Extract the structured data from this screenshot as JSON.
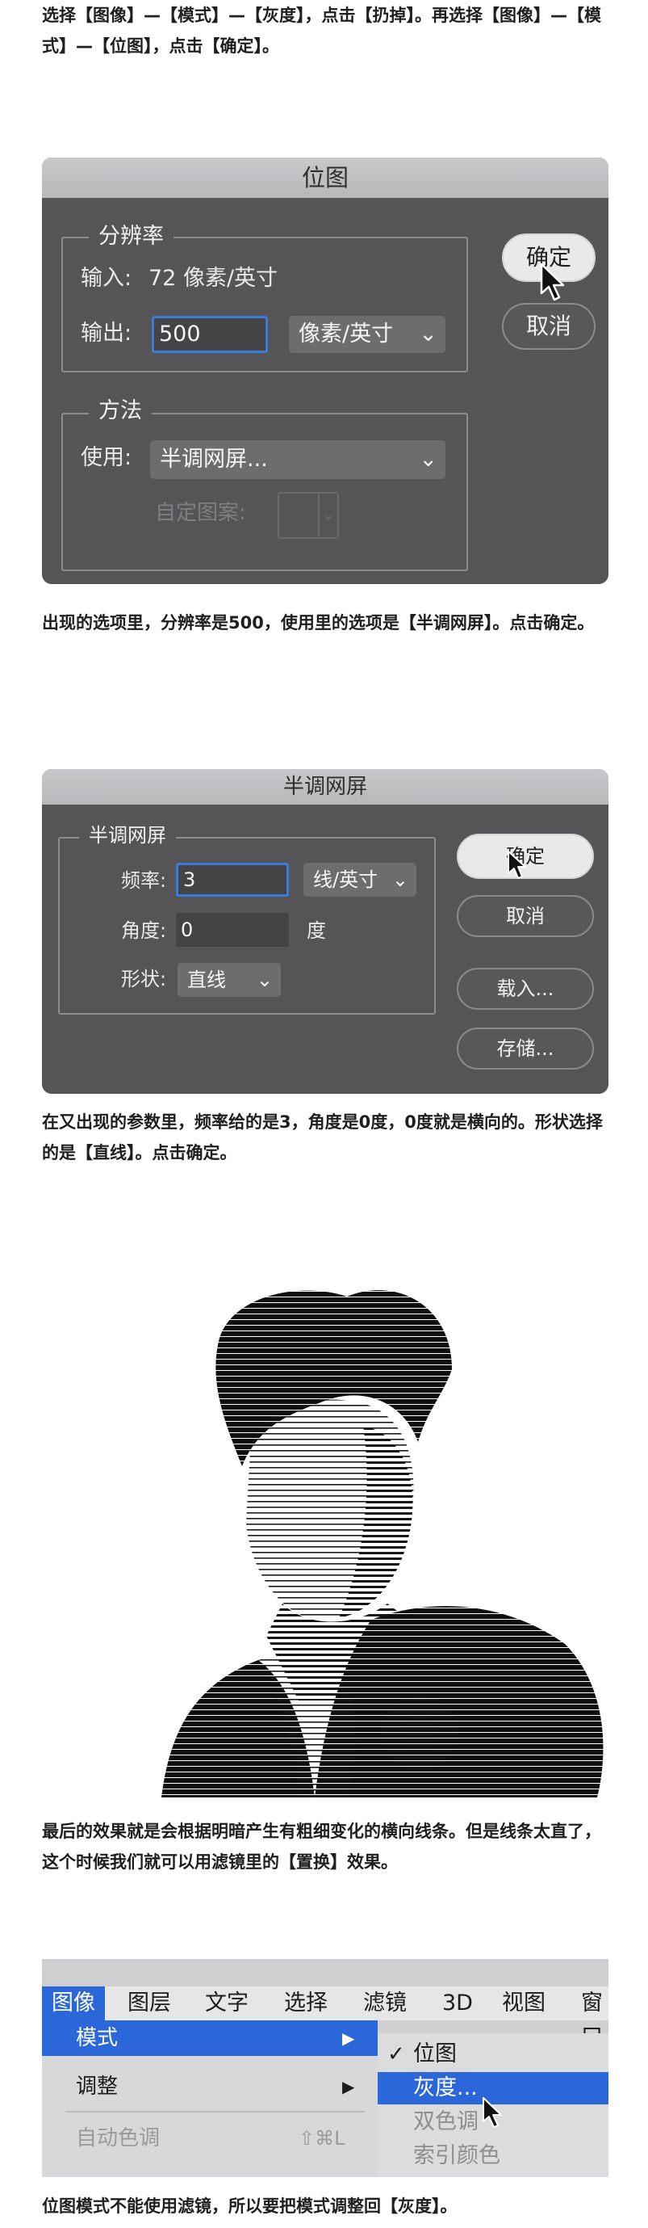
{
  "paragraphs": {
    "p1": "选择【图像】—【模式】—【灰度】，点击【扔掉】。再选择【图像】—【模式】—【位图】，点击【确定】。",
    "p2": "出现的选项里，分辨率是500，使用里的选项是【半调网屏】。点击确定。",
    "p3": "在又出现的参数里，频率给的是3，角度是0度，0度就是横向的。形状选择的是【直线】。点击确定。",
    "p4": "最后的效果就是会根据明暗产生有粗细变化的横向线条。但是线条太直了，这个时候我们就可以用滤镜里的【置换】效果。",
    "p5": "位图模式不能使用滤镜，所以要把模式调整回【灰度】。"
  },
  "bitmap_dialog": {
    "title": "位图",
    "resolution_group": "分辨率",
    "input_label": "输入:",
    "input_value": "72 像素/英寸",
    "output_label": "输出:",
    "output_value": "500",
    "output_unit": "像素/英寸",
    "method_group": "方法",
    "use_label": "使用:",
    "use_value": "半调网屏...",
    "custom_pattern_label": "自定图案:",
    "ok_button": "确定",
    "cancel_button": "取消"
  },
  "halftone_dialog": {
    "title": "半调网屏",
    "group": "半调网屏",
    "freq_label": "频率:",
    "freq_value": "3",
    "freq_unit": "线/英寸",
    "angle_label": "角度:",
    "angle_value": "0",
    "angle_unit": "度",
    "shape_label": "形状:",
    "shape_value": "直线",
    "ok_button": "确定",
    "cancel_button": "取消",
    "load_button": "载入...",
    "save_button": "存储..."
  },
  "menu": {
    "menubar": [
      "图像",
      "图层",
      "文字",
      "选择",
      "滤镜",
      "3D",
      "视图",
      "窗口"
    ],
    "dropdown": [
      {
        "label": "模式",
        "arrow": "▶"
      },
      {
        "label": "调整",
        "arrow": "▶"
      },
      {
        "label": "自动色调",
        "shortcut": "⇧⌘L"
      }
    ],
    "submenu": [
      {
        "label": "位图",
        "check": "✓"
      },
      {
        "label": "灰度..."
      },
      {
        "label": "双色调"
      },
      {
        "label": "索引颜色"
      }
    ]
  },
  "icons": {
    "chevron": "chevron-down-icon",
    "cursor": "mouse-pointer-icon",
    "submenu_arrow": "triangle-right-icon",
    "check": "checkmark-icon"
  },
  "colors": {
    "dialog_bg": "#555558",
    "accent_blue": "#2b67d8",
    "field_border": "#3c7bd9"
  }
}
